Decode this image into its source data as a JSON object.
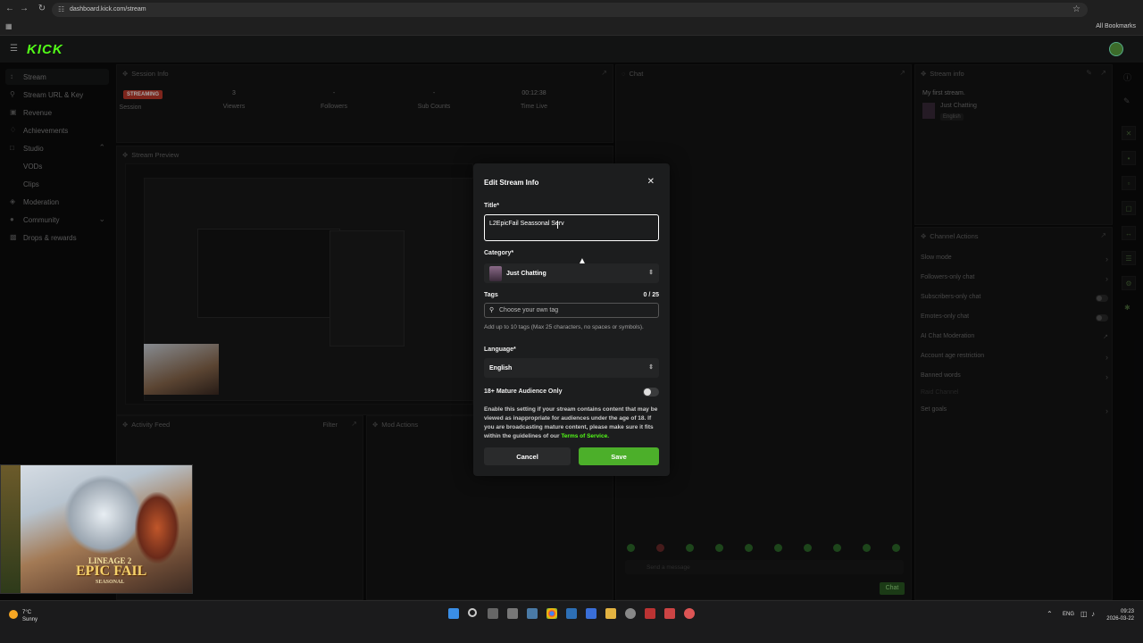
{
  "browser": {
    "url": "dashboard.kick.com/stream",
    "all_bookmarks": "All Bookmarks"
  },
  "brand": {
    "logo": "KICK",
    "accent": "#53fc18"
  },
  "sidebar": {
    "items": [
      {
        "label": "Stream",
        "icon": "stream-icon"
      },
      {
        "label": "Stream URL & Key",
        "icon": "key-icon"
      },
      {
        "label": "Revenue",
        "icon": "revenue-icon"
      },
      {
        "label": "Achievements",
        "icon": "trophy-icon"
      },
      {
        "label": "Studio",
        "icon": "studio-icon"
      },
      {
        "label": "VODs",
        "icon": ""
      },
      {
        "label": "Clips",
        "icon": ""
      },
      {
        "label": "Moderation",
        "icon": "shield-icon"
      },
      {
        "label": "Community",
        "icon": "community-icon"
      },
      {
        "label": "Drops & rewards",
        "icon": "gift-icon"
      }
    ]
  },
  "session_info": {
    "title": "Session Info",
    "badge": "STREAMING",
    "stats": [
      {
        "value": "",
        "label": "Session"
      },
      {
        "value": "3",
        "label": "Viewers"
      },
      {
        "value": "-",
        "label": "Followers"
      },
      {
        "value": "-",
        "label": "Sub Counts"
      },
      {
        "value": "00:12:38",
        "label": "Time Live"
      }
    ]
  },
  "chat": {
    "title": "Chat",
    "input_placeholder": "Send a message",
    "send_label": "Chat"
  },
  "stream_info": {
    "title": "Stream info",
    "stream_title": "My first stream.",
    "category": "Just Chatting",
    "language": "English"
  },
  "stream_preview": {
    "title": "Stream Preview"
  },
  "activity_feed": {
    "title": "Activity Feed",
    "filter": "Filter"
  },
  "mod_actions": {
    "title": "Mod Actions"
  },
  "channel_actions": {
    "title": "Channel Actions",
    "items": [
      {
        "label": "Slow mode",
        "control": "chevron"
      },
      {
        "label": "Followers-only chat",
        "control": "chevron"
      },
      {
        "label": "Subscribers-only chat",
        "control": "toggle"
      },
      {
        "label": "Emotes-only chat",
        "control": "toggle"
      },
      {
        "label": "AI Chat Moderation",
        "control": "external"
      },
      {
        "label": "Account age restriction",
        "control": "chevron"
      },
      {
        "label": "Banned words",
        "control": "chevron"
      },
      {
        "label": "Raid Channel",
        "control": "none"
      },
      {
        "label": "Set goals",
        "control": "chevron"
      }
    ]
  },
  "modal": {
    "title": "Edit Stream Info",
    "title_label": "Title*",
    "title_value": "L2EpicFail Seassonal Serv",
    "category_label": "Category*",
    "category_value": "Just Chatting",
    "tags_label": "Tags",
    "tags_count": "0 / 25",
    "tags_placeholder": "Choose your own tag",
    "tags_help": "Add up to 10 tags (Max 25 characters, no spaces or symbols).",
    "language_label": "Language*",
    "language_value": "English",
    "mature_label": "18+ Mature Audience Only",
    "mature_enabled": false,
    "disclaimer": "Enable this setting if your stream contains content that may be viewed as inappropriate for audiences under the age of 18. If you are broadcasting mature content, please make sure it fits within the guidelines of our",
    "tos_link": "Terms of Service.",
    "cancel": "Cancel",
    "save": "Save"
  },
  "webcam_overlay": {
    "line1": "LINEAGE 2",
    "line2": "EPIC FAIL",
    "line3": "SEASONAL"
  },
  "taskbar": {
    "weather_temp": "7°C",
    "weather_desc": "Sunny",
    "lang": "ENG",
    "time": "09:23",
    "date": "2026-03-22"
  }
}
